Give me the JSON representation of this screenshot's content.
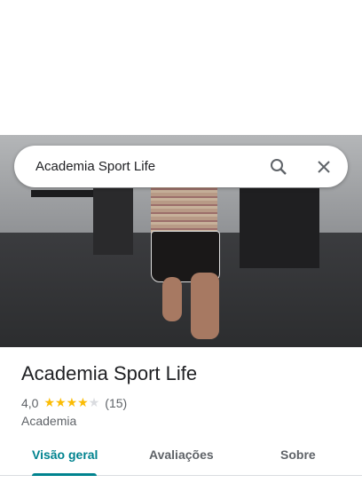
{
  "search": {
    "query": "Academia Sport Life"
  },
  "place": {
    "name": "Academia Sport Life",
    "rating": "4,0",
    "stars": 4,
    "review_count": "(15)",
    "category": "Academia"
  },
  "tabs": [
    {
      "label": "Visão geral",
      "active": true
    },
    {
      "label": "Avaliações"
    },
    {
      "label": "Sobre"
    }
  ],
  "colors": {
    "accent": "#00838f",
    "star": "#fbbc04"
  }
}
